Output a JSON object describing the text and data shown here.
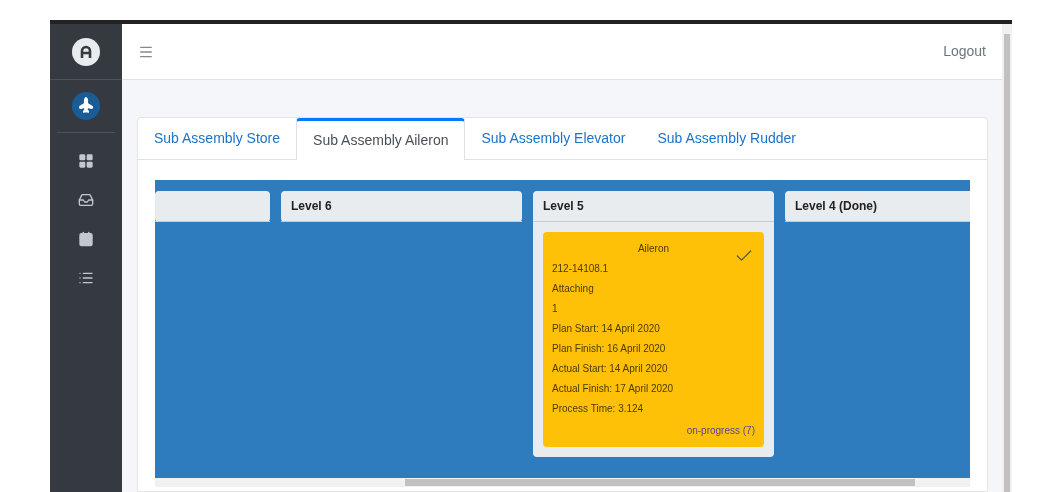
{
  "header": {
    "logout": "Logout"
  },
  "sidebar": {
    "items": [
      {
        "kind": "grid"
      },
      {
        "kind": "tray"
      },
      {
        "kind": "calendar"
      },
      {
        "kind": "list"
      }
    ]
  },
  "tabs": [
    {
      "label": "Sub Assembly Store",
      "selected": false
    },
    {
      "label": "Sub Assembly Aileron",
      "selected": true
    },
    {
      "label": "Sub Assembly Elevator",
      "selected": false
    },
    {
      "label": "Sub Assembly Rudder",
      "selected": false
    }
  ],
  "columns": [
    {},
    {
      "title": "Level 6"
    },
    {
      "title": "Level 5",
      "cards": [
        {
          "title": "Aileron",
          "done": true,
          "lines": [
            "212-14108.1",
            "Attaching",
            "1",
            "Plan Start: 14 April 2020",
            "Plan Finish: 16 April 2020",
            "Actual Start: 14 April 2020",
            "Actual Finish: 17 April 2020",
            "Process Time: 3.124"
          ],
          "status": "on-progress (7)"
        }
      ]
    },
    {
      "title": "Level 4 (Done)"
    }
  ]
}
